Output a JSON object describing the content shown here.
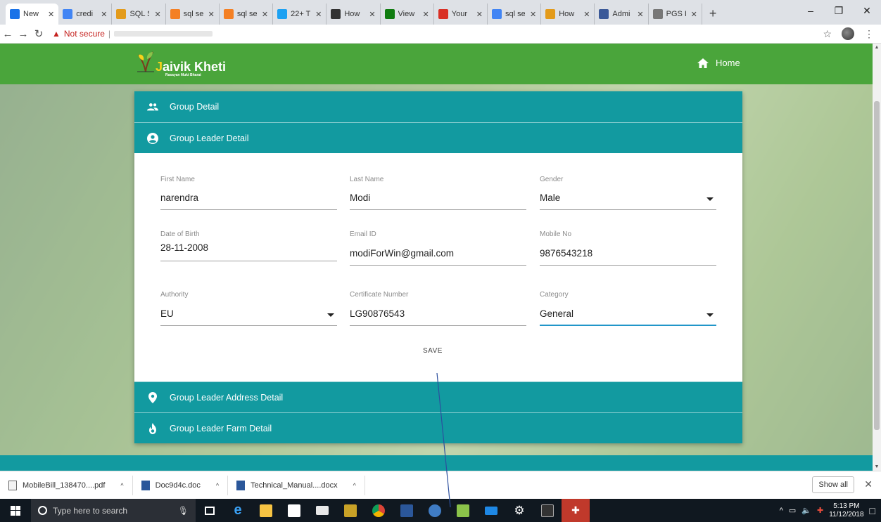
{
  "browser": {
    "tabs": [
      {
        "label": "New",
        "color": "#1a73e8"
      },
      {
        "label": "credi",
        "color": "#4285f4"
      },
      {
        "label": "SQL S",
        "color": "#e39b1b"
      },
      {
        "label": "sql se",
        "color": "#f48024"
      },
      {
        "label": "sql se",
        "color": "#f48024"
      },
      {
        "label": "22+ T",
        "color": "#1da1f2"
      },
      {
        "label": "How",
        "color": "#333333"
      },
      {
        "label": "View",
        "color": "#107c10"
      },
      {
        "label": "Your",
        "color": "#d93025"
      },
      {
        "label": "sql se",
        "color": "#4285f4"
      },
      {
        "label": "How",
        "color": "#e39b1b"
      },
      {
        "label": "Admi",
        "color": "#3b5998"
      },
      {
        "label": "PGS I",
        "color": "#777777"
      }
    ],
    "address": {
      "security_label": "Not secure"
    }
  },
  "header": {
    "logo_main": "aivik Kheti",
    "logo_first": "J",
    "logo_sub": "Rasayan Mukt Bharat",
    "home_label": "Home"
  },
  "panels": {
    "group_detail": "Group Detail",
    "leader_detail": "Group Leader Detail",
    "address_detail": "Group Leader Address Detail",
    "farm_detail": "Group Leader Farm Detail"
  },
  "form": {
    "first_name": {
      "label": "First Name",
      "value": "narendra"
    },
    "last_name": {
      "label": "Last Name",
      "value": "Modi"
    },
    "gender": {
      "label": "Gender",
      "value": "Male"
    },
    "dob": {
      "label": "Date of Birth",
      "value": "28-11-2008"
    },
    "email": {
      "label": "Email ID",
      "value": "modiForWin@gmail.com"
    },
    "mobile": {
      "label": "Mobile No",
      "value": "9876543218"
    },
    "authority": {
      "label": "Authority",
      "value": "EU"
    },
    "certificate": {
      "label": "Certificate Number",
      "value": "LG90876543"
    },
    "category": {
      "label": "Category",
      "value": "General"
    },
    "save_label": "SAVE"
  },
  "downloads": {
    "items": [
      {
        "name": "MobileBill_138470....pdf"
      },
      {
        "name": "Doc9d4c.doc"
      },
      {
        "name": "Technical_Manual....docx"
      }
    ],
    "show_all": "Show all"
  },
  "taskbar": {
    "search_placeholder": "Type here to search",
    "time": "5:13 PM",
    "date": "11/12/2018"
  },
  "colors": {
    "teal": "#129aa0",
    "green": "#4aa53b",
    "focus": "#2196c9"
  }
}
